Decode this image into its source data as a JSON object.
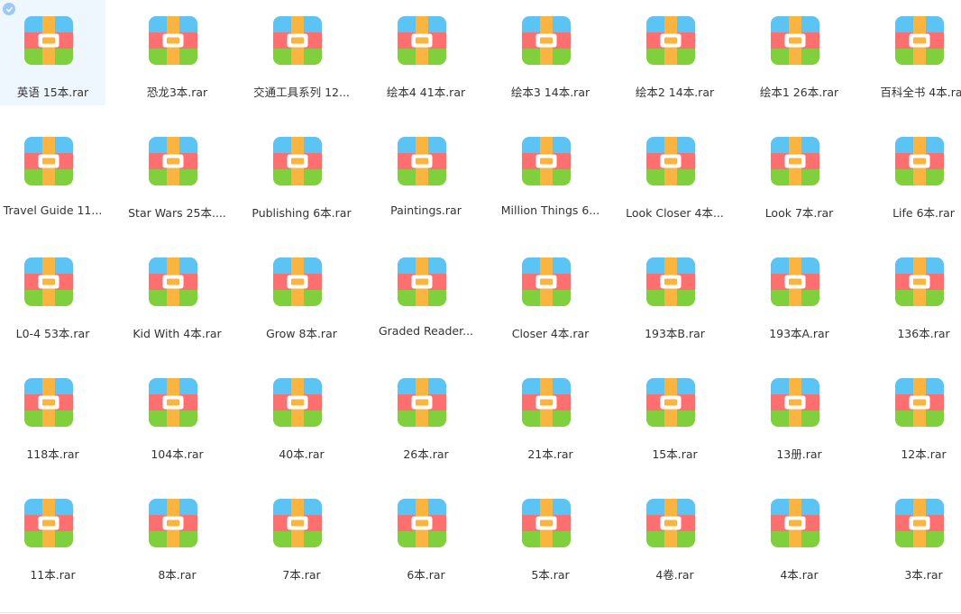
{
  "icon_name": "archive-icon",
  "colors": {
    "blue": "#5bc4f5",
    "red": "#fe6f6f",
    "green": "#80cf3d",
    "strap": "#f9b53f",
    "selection": "#eef6fe",
    "check": "#9ec9f5"
  },
  "files": [
    {
      "name": "英语 15本.rar",
      "selected": true
    },
    {
      "name": "恐龙3本.rar"
    },
    {
      "name": "交通工具系列 12..."
    },
    {
      "name": "绘本4 41本.rar"
    },
    {
      "name": "绘本3 14本.rar"
    },
    {
      "name": "绘本2 14本.rar"
    },
    {
      "name": "绘本1 26本.rar"
    },
    {
      "name": "百科全书 4本.rar"
    },
    {
      "name": "Travel Guide 11..."
    },
    {
      "name": "Star Wars 25本...."
    },
    {
      "name": "Publishing 6本.rar"
    },
    {
      "name": "Paintings.rar"
    },
    {
      "name": "Million Things 6..."
    },
    {
      "name": "Look Closer 4本..."
    },
    {
      "name": "Look 7本.rar"
    },
    {
      "name": "Life 6本.rar"
    },
    {
      "name": "L0-4 53本.rar"
    },
    {
      "name": "Kid With 4本.rar"
    },
    {
      "name": "Grow 8本.rar"
    },
    {
      "name": "Graded Reader..."
    },
    {
      "name": "Closer 4本.rar"
    },
    {
      "name": "193本B.rar"
    },
    {
      "name": "193本A.rar"
    },
    {
      "name": "136本.rar"
    },
    {
      "name": "118本.rar"
    },
    {
      "name": "104本.rar"
    },
    {
      "name": "40本.rar"
    },
    {
      "name": "26本.rar"
    },
    {
      "name": "21本.rar"
    },
    {
      "name": "15本.rar"
    },
    {
      "name": "13册.rar"
    },
    {
      "name": "12本.rar"
    },
    {
      "name": "11本.rar"
    },
    {
      "name": "8本.rar"
    },
    {
      "name": "7本.rar"
    },
    {
      "name": "6本.rar"
    },
    {
      "name": "5本.rar"
    },
    {
      "name": "4卷.rar"
    },
    {
      "name": "4本.rar"
    },
    {
      "name": "3本.rar"
    }
  ]
}
